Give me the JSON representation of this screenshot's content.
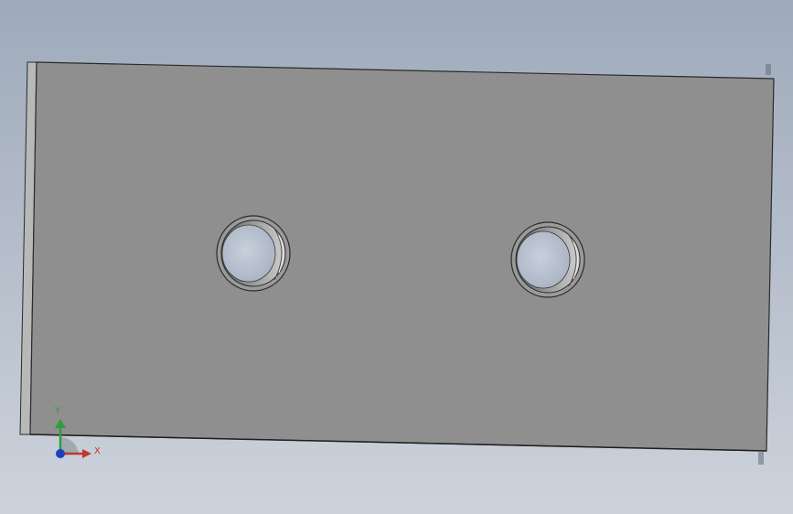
{
  "viewport": {
    "background_top": "#9eaabb",
    "background_bottom": "#cdd3dc"
  },
  "part": {
    "face_color": "#8f8f8f",
    "edge_color": "#2a2a2a",
    "side_face_color": "#b8b8b8",
    "holes": [
      {
        "name": "left-hole"
      },
      {
        "name": "right-hole"
      }
    ]
  },
  "triad": {
    "x_label": "X",
    "y_label": "Y",
    "x_color": "#c0392b",
    "y_color": "#2e9e3a",
    "z_color": "#1f3fbf"
  }
}
